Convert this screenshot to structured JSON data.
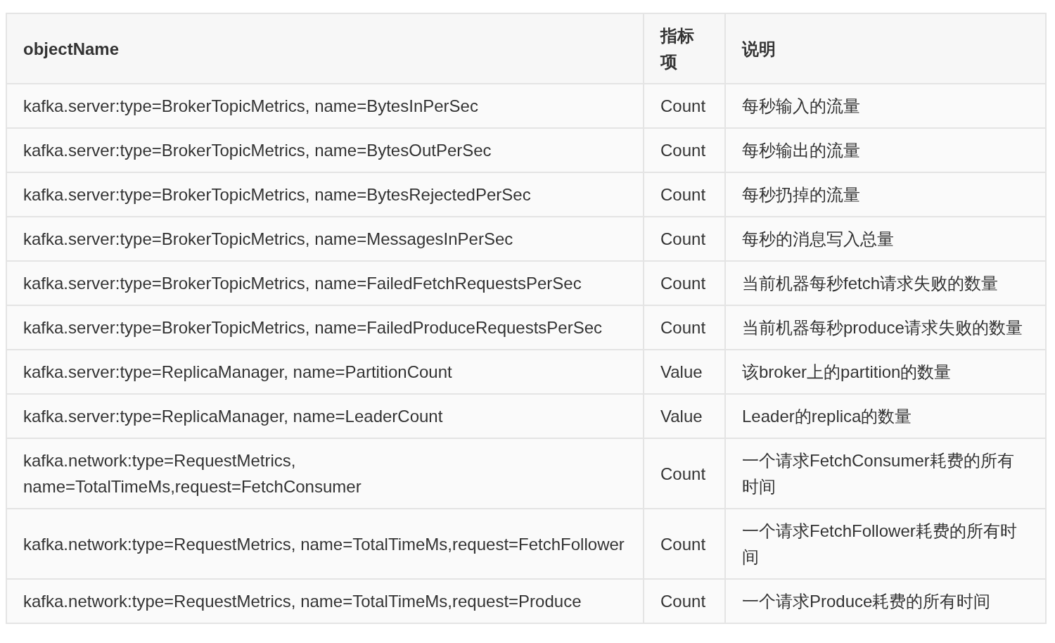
{
  "table": {
    "columns": [
      "objectName",
      "指标项",
      "说明"
    ],
    "rows": [
      [
        "kafka.server:type=BrokerTopicMetrics, name=BytesInPerSec",
        "Count",
        "每秒输入的流量"
      ],
      [
        "kafka.server:type=BrokerTopicMetrics, name=BytesOutPerSec",
        "Count",
        "每秒输出的流量"
      ],
      [
        "kafka.server:type=BrokerTopicMetrics, name=BytesRejectedPerSec",
        "Count",
        "每秒扔掉的流量"
      ],
      [
        "kafka.server:type=BrokerTopicMetrics, name=MessagesInPerSec",
        "Count",
        "每秒的消息写入总量"
      ],
      [
        "kafka.server:type=BrokerTopicMetrics, name=FailedFetchRequestsPerSec",
        "Count",
        "当前机器每秒fetch请求失败的数量"
      ],
      [
        "kafka.server:type=BrokerTopicMetrics, name=FailedProduceRequestsPerSec",
        "Count",
        "当前机器每秒produce请求失败的数量"
      ],
      [
        "kafka.server:type=ReplicaManager, name=PartitionCount",
        "Value",
        "该broker上的partition的数量"
      ],
      [
        "kafka.server:type=ReplicaManager, name=LeaderCount",
        "Value",
        "Leader的replica的数量"
      ],
      [
        "kafka.network:type=RequestMetrics, name=TotalTimeMs,request=FetchConsumer",
        "Count",
        "一个请求FetchConsumer耗费的所有时间"
      ],
      [
        "kafka.network:type=RequestMetrics, name=TotalTimeMs,request=FetchFollower",
        "Count",
        "一个请求FetchFollower耗费的所有时间"
      ],
      [
        "kafka.network:type=RequestMetrics, name=TotalTimeMs,request=Produce",
        "Count",
        "一个请求Produce耗费的所有时间"
      ]
    ]
  }
}
